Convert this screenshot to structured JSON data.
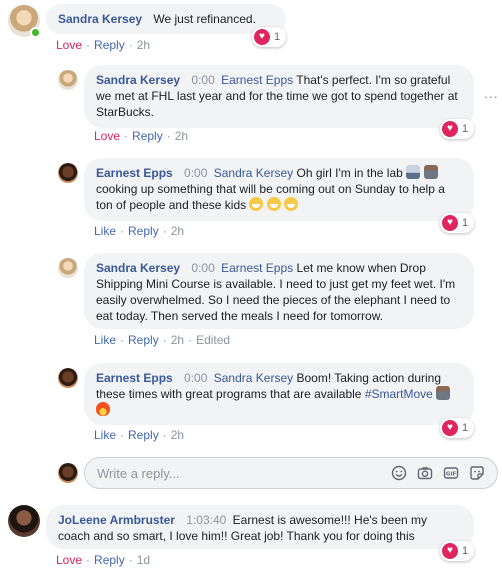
{
  "comments": [
    {
      "author": "Sandra Kersey",
      "timestamp": "",
      "mention": "",
      "text": "We just refinanced.",
      "actions": [
        "Love",
        "Reply",
        "2h"
      ],
      "reactions": "1"
    },
    {
      "author": "Sandra Kersey",
      "timestamp": "0:00",
      "mention": "Earnest Epps",
      "text": "That's perfect. I'm so grateful we met at FHL last year and for the time we got to spend together at StarBucks.",
      "actions": [
        "Love",
        "Reply",
        "2h"
      ],
      "reactions": "1"
    },
    {
      "author": "Earnest Epps",
      "timestamp": "0:00",
      "mention": "Sandra Kersey",
      "text_a": "Oh girl I'm in the lab",
      "text_b": "cooking up something that will be coming out on Sunday to help a ton of people and these kids",
      "actions": [
        "Like",
        "Reply",
        "2h"
      ],
      "reactions": "1"
    },
    {
      "author": "Sandra Kersey",
      "timestamp": "0:00",
      "mention": "Earnest Epps",
      "text": "Let me know when Drop Shipping Mini Course is available. I need to just get my feet wet. I'm easily overwhelmed. So I need the pieces of the elephant I need to eat today. Then served the meals I need for tomorrow.",
      "actions": [
        "Like",
        "Reply",
        "2h",
        "Edited"
      ],
      "reactions": ""
    },
    {
      "author": "Earnest Epps",
      "timestamp": "0:00",
      "mention": "Sandra Kersey",
      "text": "Boom! Taking action during these times with great programs that are available",
      "hashtag": "#SmartMove",
      "actions": [
        "Like",
        "Reply",
        "2h"
      ],
      "reactions": "1"
    },
    {
      "author": "JoLeene Armbruster",
      "timestamp": "1:03:40",
      "mention": "",
      "text": "Earnest is awesome!!! He's been my coach and so smart, I love him!! Great job! Thank you for doing this",
      "actions": [
        "Love",
        "Reply",
        "1d"
      ],
      "reactions": "1"
    }
  ],
  "reply_box": {
    "placeholder": "Write a reply..."
  },
  "more_options": "...",
  "icons": {
    "reaction": "heart-icon",
    "reply_tools": [
      "emoji-icon",
      "camera-icon",
      "gif-icon",
      "sticker-icon"
    ]
  },
  "colors": {
    "link": "#385898",
    "love": "#e0245e",
    "bubble": "#f2f3f5",
    "online": "#42b72a"
  }
}
